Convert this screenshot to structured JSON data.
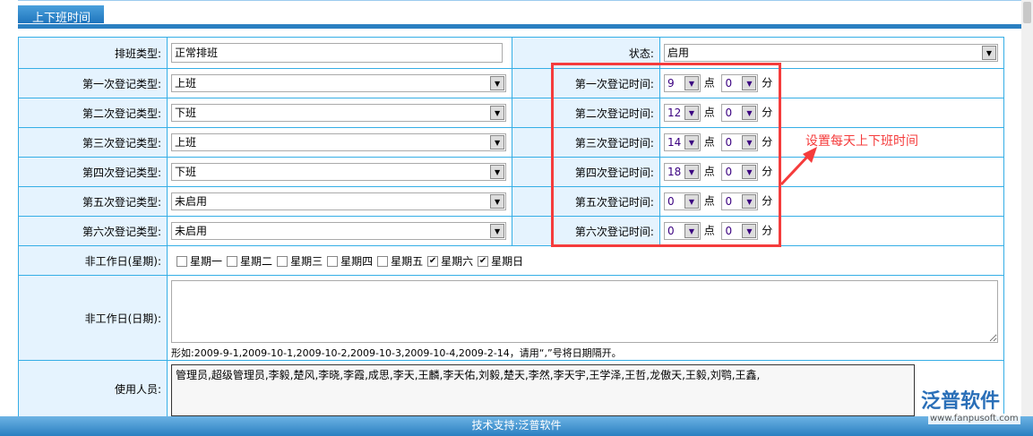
{
  "section_title": "上下班时间",
  "shift_type": {
    "label": "排班类型:",
    "value": "正常排班"
  },
  "status": {
    "label": "状态:",
    "value": "启用"
  },
  "rows": [
    {
      "type_label": "第一次登记类型:",
      "type_value": "上班",
      "time_label": "第一次登记时间:",
      "hour": "9",
      "minute": "0"
    },
    {
      "type_label": "第二次登记类型:",
      "type_value": "下班",
      "time_label": "第二次登记时间:",
      "hour": "12",
      "minute": "0"
    },
    {
      "type_label": "第三次登记类型:",
      "type_value": "上班",
      "time_label": "第三次登记时间:",
      "hour": "14",
      "minute": "0"
    },
    {
      "type_label": "第四次登记类型:",
      "type_value": "下班",
      "time_label": "第四次登记时间:",
      "hour": "18",
      "minute": "0"
    },
    {
      "type_label": "第五次登记类型:",
      "type_value": "未启用",
      "time_label": "第五次登记时间:",
      "hour": "0",
      "minute": "0"
    },
    {
      "type_label": "第六次登记类型:",
      "type_value": "未启用",
      "time_label": "第六次登记时间:",
      "hour": "0",
      "minute": "0"
    }
  ],
  "hour_unit": "点",
  "minute_unit": "分",
  "weekdays": {
    "label": "非工作日(星期):",
    "items": [
      {
        "label": "星期一",
        "checked": false
      },
      {
        "label": "星期二",
        "checked": false
      },
      {
        "label": "星期三",
        "checked": false
      },
      {
        "label": "星期四",
        "checked": false
      },
      {
        "label": "星期五",
        "checked": false
      },
      {
        "label": "星期六",
        "checked": true
      },
      {
        "label": "星期日",
        "checked": true
      }
    ]
  },
  "dates": {
    "label": "非工作日(日期):",
    "value": "",
    "hint": "形如:2009-9-1,2009-10-1,2009-10-2,2009-10-3,2009-10-4,2009-2-14，请用“,”号将日期隔开。"
  },
  "users": {
    "label": "使用人员:",
    "value": "管理员,超级管理员,李毅,楚风,李晓,李霞,成思,李天,王麟,李天佑,刘毅,楚天,李然,李天宇,王学泽,王哲,龙傲天,王毅,刘鹗,王鑫,"
  },
  "annotation": "设置每天上下班时间",
  "footer": "技术支持:泛普软件",
  "logo": {
    "name": "泛普软件",
    "url": "www.fanpusoft.com"
  },
  "colors": {
    "accent": "#2a7fc1",
    "annotation": "#f53c3c",
    "label_bg": "#e5f3fe"
  }
}
